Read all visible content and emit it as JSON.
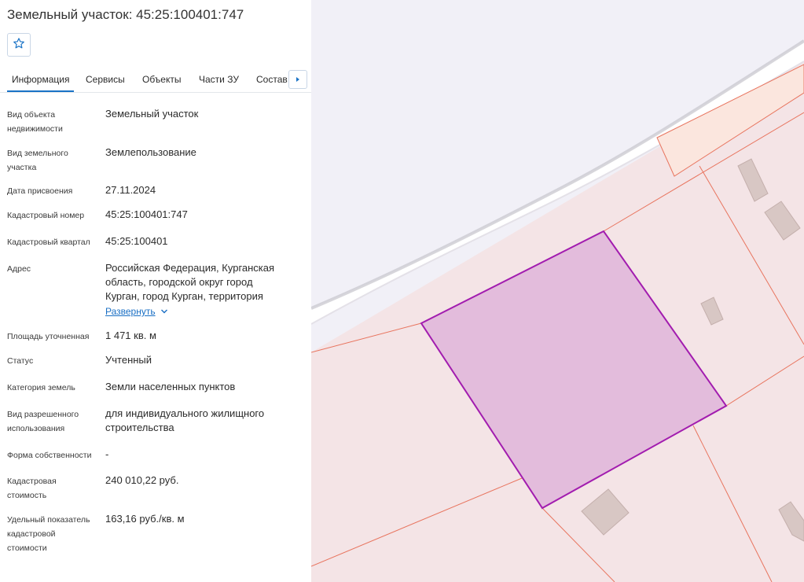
{
  "header": {
    "title": "Земельный участок: 45:25:100401:747"
  },
  "tabs": [
    {
      "label": "Информация",
      "active": true
    },
    {
      "label": "Сервисы"
    },
    {
      "label": "Объекты"
    },
    {
      "label": "Части ЗУ"
    },
    {
      "label": "Состав"
    }
  ],
  "info": {
    "object_type": {
      "label": "Вид объекта недвижимости",
      "value": "Земельный участок"
    },
    "land_type": {
      "label": "Вид земельного участка",
      "value": "Землепользование"
    },
    "date": {
      "label": "Дата присвоения",
      "value": "27.11.2024"
    },
    "cad_number": {
      "label": "Кадастровый номер",
      "value": "45:25:100401:747"
    },
    "cad_quarter": {
      "label": "Кадастровый квартал",
      "value": "45:25:100401"
    },
    "address": {
      "label": "Адрес",
      "value": "Российская Федерация, Курганская область, городской округ город Курган, город Курган, территория",
      "expand": "Развернуть"
    },
    "area": {
      "label": "Площадь уточненная",
      "value": "1 471 кв. м"
    },
    "status": {
      "label": "Статус",
      "value": "Учтенный"
    },
    "category": {
      "label": "Категория земель",
      "value": "Земли населенных пунктов"
    },
    "permitted_use": {
      "label": "Вид разрешенного использования",
      "value": "для индивидуального жилищного строительства"
    },
    "ownership": {
      "label": "Форма собственности",
      "value": "-"
    },
    "cad_value": {
      "label": "Кадастровая стоимость",
      "value": "240 010,22 руб."
    },
    "specific_value": {
      "label": "Удельный показатель кадастровой стоимости",
      "value": "163,16 руб./кв. м"
    }
  },
  "colors": {
    "accent": "#1a73c6",
    "parcel_fill": "#e3bcdc",
    "parcel_stroke": "#a21caf",
    "boundary": "#e8745e",
    "land_fill": "#f4e4e6",
    "road_fill": "#f1f0f7",
    "building": "#d5c4c1"
  }
}
